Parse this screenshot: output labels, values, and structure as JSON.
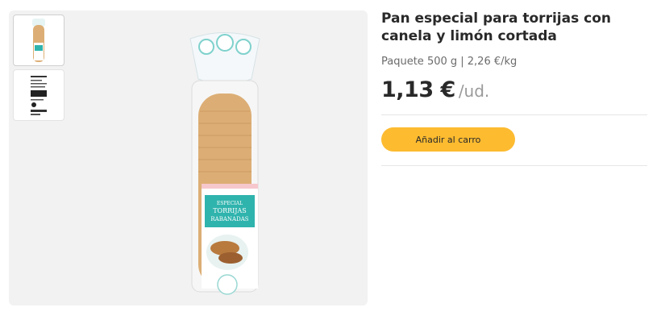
{
  "product": {
    "title": "Pan especial para torrijas con canela y limón cortada",
    "subtitle": "Paquete 500 g | 2,26 €/kg",
    "price": "1,13 €",
    "unit": "/ud.",
    "add_to_cart_label": "Añadir al carro"
  },
  "package_label": {
    "line1": "ESPECIAL",
    "line2": "TORRIJAS",
    "line3": "RABANADAS"
  },
  "thumbnails": [
    {
      "name": "bread-front",
      "selected": true
    },
    {
      "name": "nutrition-label",
      "selected": false
    }
  ],
  "colors": {
    "accent": "#fdbb30",
    "label_teal": "#2fb3ad",
    "gallery_bg": "#f2f2f2"
  }
}
